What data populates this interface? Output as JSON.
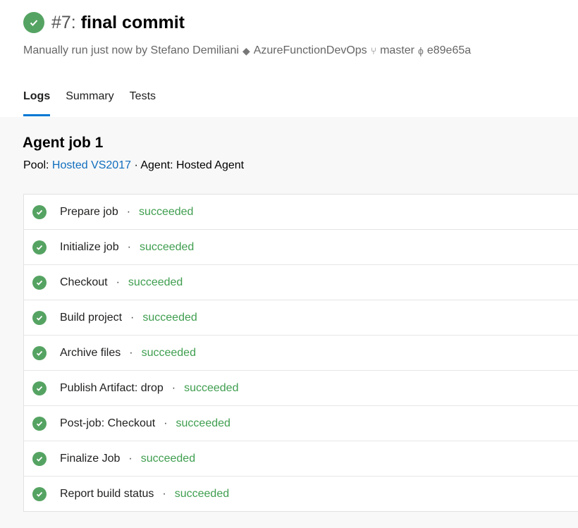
{
  "header": {
    "run_number": "#7:",
    "title": "final commit",
    "subtitle": {
      "trigger": "Manually run just now by Stefano Demiliani",
      "repo": "AzureFunctionDevOps",
      "branch": "master",
      "commit": "e89e65a"
    },
    "tabs": [
      {
        "label": "Logs",
        "active": true
      },
      {
        "label": "Summary"
      },
      {
        "label": "Tests"
      }
    ]
  },
  "job": {
    "title": "Agent job 1",
    "pool_label": "Pool:",
    "pool_value": "Hosted VS2017",
    "agent": "· Agent: Hosted Agent",
    "steps": [
      {
        "name": "Prepare job",
        "status": "succeeded"
      },
      {
        "name": "Initialize job",
        "status": "succeeded"
      },
      {
        "name": "Checkout",
        "status": "succeeded"
      },
      {
        "name": "Build project",
        "status": "succeeded"
      },
      {
        "name": "Archive files",
        "status": "succeeded"
      },
      {
        "name": "Publish Artifact: drop",
        "status": "succeeded"
      },
      {
        "name": "Post-job: Checkout",
        "status": "succeeded"
      },
      {
        "name": "Finalize Job",
        "status": "succeeded"
      },
      {
        "name": "Report build status",
        "status": "succeeded"
      }
    ]
  },
  "colors": {
    "success": "#55a362",
    "accent": "#0078d4",
    "link": "#106ebe"
  }
}
